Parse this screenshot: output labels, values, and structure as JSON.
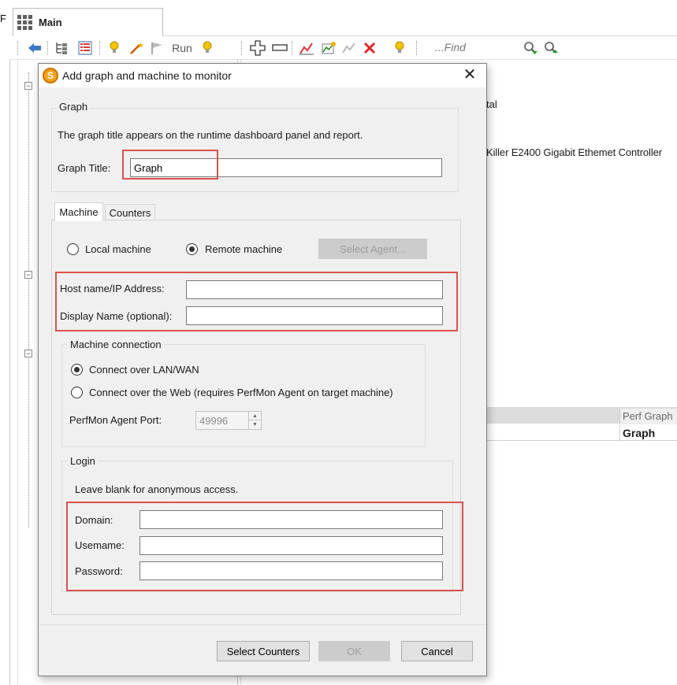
{
  "app": {
    "left_edge_text": "F",
    "doc_tab_label": "Main",
    "toolbar": {
      "run_label": "Run",
      "find_placeholder": "...Find"
    },
    "background_text": {
      "line1": "tal",
      "line2": "Killer E2400 Gigabit Ethemet Controller"
    },
    "grid": {
      "column_header": "Perf Graph",
      "cell_value": "Graph"
    }
  },
  "dialog": {
    "title": "Add graph and machine to monitor",
    "graph_group": {
      "title": "Graph",
      "description": "The graph title appears on the runtime dashboard panel and report.",
      "title_label": "Graph Title:",
      "title_value": "Graph"
    },
    "tabs": [
      {
        "label": "Machine",
        "active": true
      },
      {
        "label": "Counters",
        "active": false
      }
    ],
    "machine_tab": {
      "local_machine_label": "Local machine",
      "remote_machine_label": "Remote machine",
      "selected_machine": "Remote machine",
      "select_agent_label": "Select Agent...",
      "host_label": "Host name/IP Address:",
      "host_value": "",
      "display_name_label": "Display Name (optional):",
      "display_name_value": "",
      "connection_group": {
        "title": "Machine connection",
        "lan_label": "Connect over LAN/WAN",
        "web_label": "Connect over the Web (requires PerfMon Agent on target machine)",
        "selected": "Connect over LAN/WAN",
        "port_label": "PerfMon Agent Port:",
        "port_value": "49996"
      },
      "login_group": {
        "title": "Login",
        "note": "Leave blank for anonymous access.",
        "domain_label": "Domain:",
        "domain_value": "",
        "username_label": "Usemame:",
        "username_value": "",
        "password_label": "Password:",
        "password_value": ""
      }
    },
    "buttons": {
      "select_counters": "Select Counters",
      "ok": "OK",
      "cancel": "Cancel"
    }
  },
  "colors": {
    "highlight_border": "#d9534f",
    "dialog_background": "#f0f0f0",
    "disabled_button": "#cccccc"
  }
}
